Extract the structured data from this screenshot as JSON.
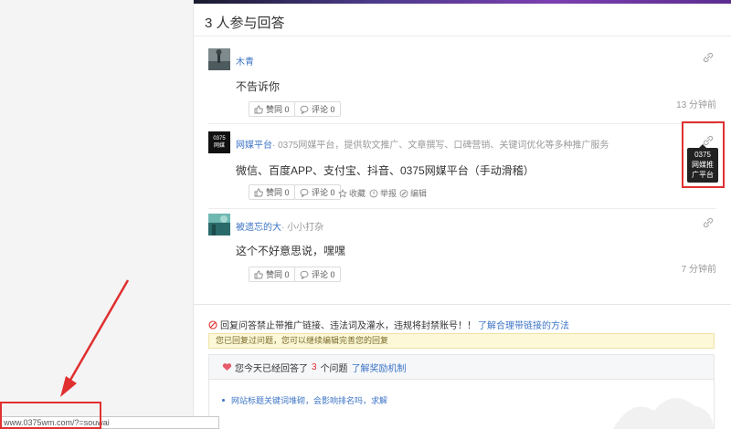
{
  "header": {
    "answer_count_title": "3 人参与回答"
  },
  "answers": [
    {
      "username": "木青",
      "description": "",
      "text": "不告诉你",
      "time": "13 分钟前",
      "like": "赞同 0",
      "comment": "评论 0"
    },
    {
      "username": "网媒平台",
      "description": "0375网媒平台，提供软文推广、文章撰写、口碑营销、关键词优化等多种推广服务",
      "avatar_text": "0375\n网媒",
      "text": "微信、百度APP、支付宝、抖音、0375网媒平台（手动滑稽）",
      "like": "赞同 0",
      "comment": "评论 0",
      "collect": "收藏",
      "report": "举报",
      "edit": "编辑"
    },
    {
      "username": "被遗忘的大",
      "description": "小小打杂",
      "text": "这个不好意思说，嘿嘿",
      "time": "7 分钟前",
      "like": "赞同 0",
      "comment": "评论 0"
    }
  ],
  "tooltip": {
    "line1": "0375",
    "line2": "网媒推",
    "line3": "广平台"
  },
  "footer": {
    "notice_text": "回复问答禁止带推广链接、违法词及灌水，违规将封禁账号！！",
    "notice_link": "了解合理带链接的方法",
    "already_answered": "您已回复过问题，您可以继续编辑完善您的回复",
    "reward_prefix": "您今天已经回答了",
    "reward_count": "3",
    "reward_suffix": "个问题",
    "reward_link": "了解奖励机制",
    "reward_item": "网站标题关键词堆砌，会影响排名吗，求解"
  },
  "status_bar": {
    "url": "www.0375wm.com/?=souwai"
  },
  "colors": {
    "accent_link": "#3d74c6",
    "highlight_red": "#e03030",
    "notice_bg": "#fcf8d8"
  }
}
